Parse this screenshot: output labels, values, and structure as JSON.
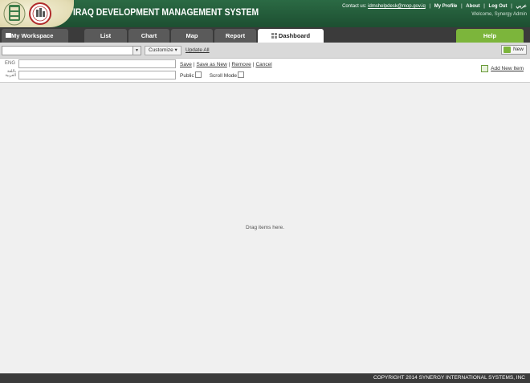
{
  "header": {
    "title": "IRAQ DEVELOPMENT MANAGEMENT SYSTEM",
    "contact_label": "Contact us:",
    "contact_email": "idmshelpdesk@mop.gov.iq",
    "links": [
      "My Profile",
      "About",
      "Log Out",
      "عربي"
    ],
    "welcome": "Welcome,  Synergy Admin"
  },
  "nav": {
    "workspace": "My Workspace",
    "tabs": [
      "List",
      "Chart",
      "Map",
      "Report",
      "Dashboard"
    ],
    "active_tab": "Dashboard",
    "help": "Help"
  },
  "toolbar": {
    "customize": "Customize",
    "update_all": "Update All",
    "new": "New"
  },
  "editor": {
    "lang_eng": "ENG",
    "lang_ar": "باللغة العربية",
    "actions": [
      "Save",
      "Save as New",
      "Remove",
      "Cancel"
    ],
    "public_label": "Public",
    "scroll_mode_label": "Scroll Mode",
    "add_new_item": "Add New Item"
  },
  "canvas": {
    "hint": "Drag items here."
  },
  "footer": {
    "copyright": "COPYRIGHT 2014 SYNERGY INTERNATIONAL SYSTEMS, INC"
  },
  "colors": {
    "header_green": "#1d4f31",
    "help_green": "#7cb53b",
    "nav_dark": "#3b3b3b"
  }
}
